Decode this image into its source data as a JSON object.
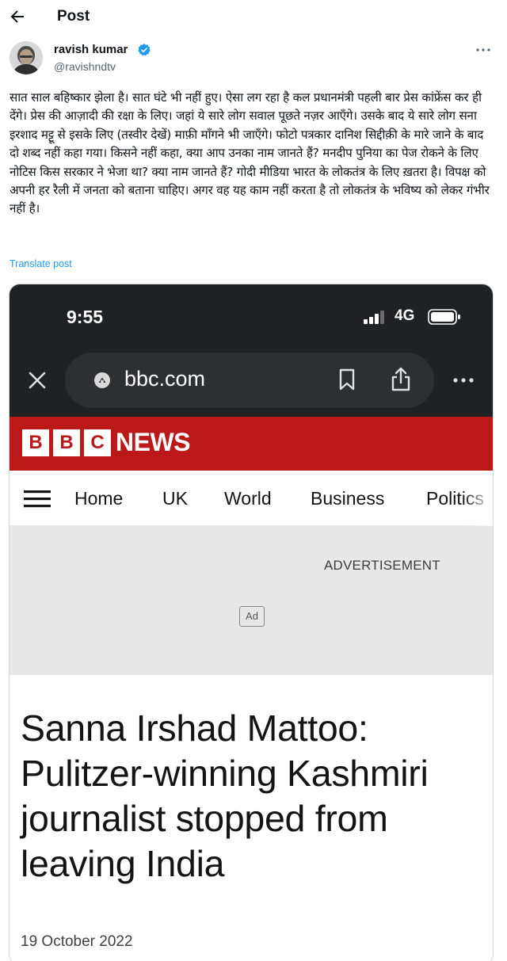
{
  "header": {
    "title": "Post",
    "back_icon": "arrow-left-icon"
  },
  "author": {
    "display_name": "ravish kumar",
    "handle": "@ravishndtv",
    "verified": true,
    "verified_color": "#1d9bf0"
  },
  "post": {
    "text": "सात साल बहिष्कार झेला है। सात घंटे भी नहीं हुए। ऐसा लग रहा है कल प्रधानमंत्री पहली बार प्रेस कांफ्रेंस कर ही देंगे। प्रेस की आज़ादी की रक्षा के लिए। जहां ये सारे लोग सवाल पूछते नज़र आएँगे। उसके बाद ये सारे लोग सना इरशाद मट्टू से इसके लिए (तस्वीर देखें) माफ़ी माँगने भी जाएँगे। फोटो पत्रकार दानिश सिद्दीक़ी के मारे जाने के बाद दो शब्द नहीं कहा गया। किसने नहीं कहा, क्या आप उनका नाम जानते हैं? मनदीप पुनिया का  पेज रोकने के लिए नोटिस किस सरकार ने भेजा था? क्या नाम जानते हैं? गोदी मीडिया भारत के लोकतंत्र के लिए ख़तरा है। विपक्ष को अपनी हर रैली में जनता को बताना चाहिए। अगर वह यह काम नहीं करता है तो लोकतंत्र के भविष्य को लेकर गंभीर नहीं है।",
    "translate_label": "Translate post",
    "link_color": "#1d9bf0"
  },
  "screenshot": {
    "status_bar": {
      "time": "9:55",
      "network": "4G"
    },
    "browser": {
      "url": "bbc.com"
    },
    "bbc": {
      "letters": [
        "B",
        "B",
        "C"
      ],
      "news_label": "NEWS",
      "brand_color": "#bb1919",
      "nav": [
        "Home",
        "UK",
        "World",
        "Business",
        "Politics"
      ]
    },
    "ad": {
      "label": "ADVERTISEMENT",
      "badge": "Ad"
    },
    "article": {
      "headline": "Sanna Irshad Mattoo: Pulitzer-winning Kashmiri journalist stopped from leaving India",
      "date": "19 October 2022"
    }
  }
}
